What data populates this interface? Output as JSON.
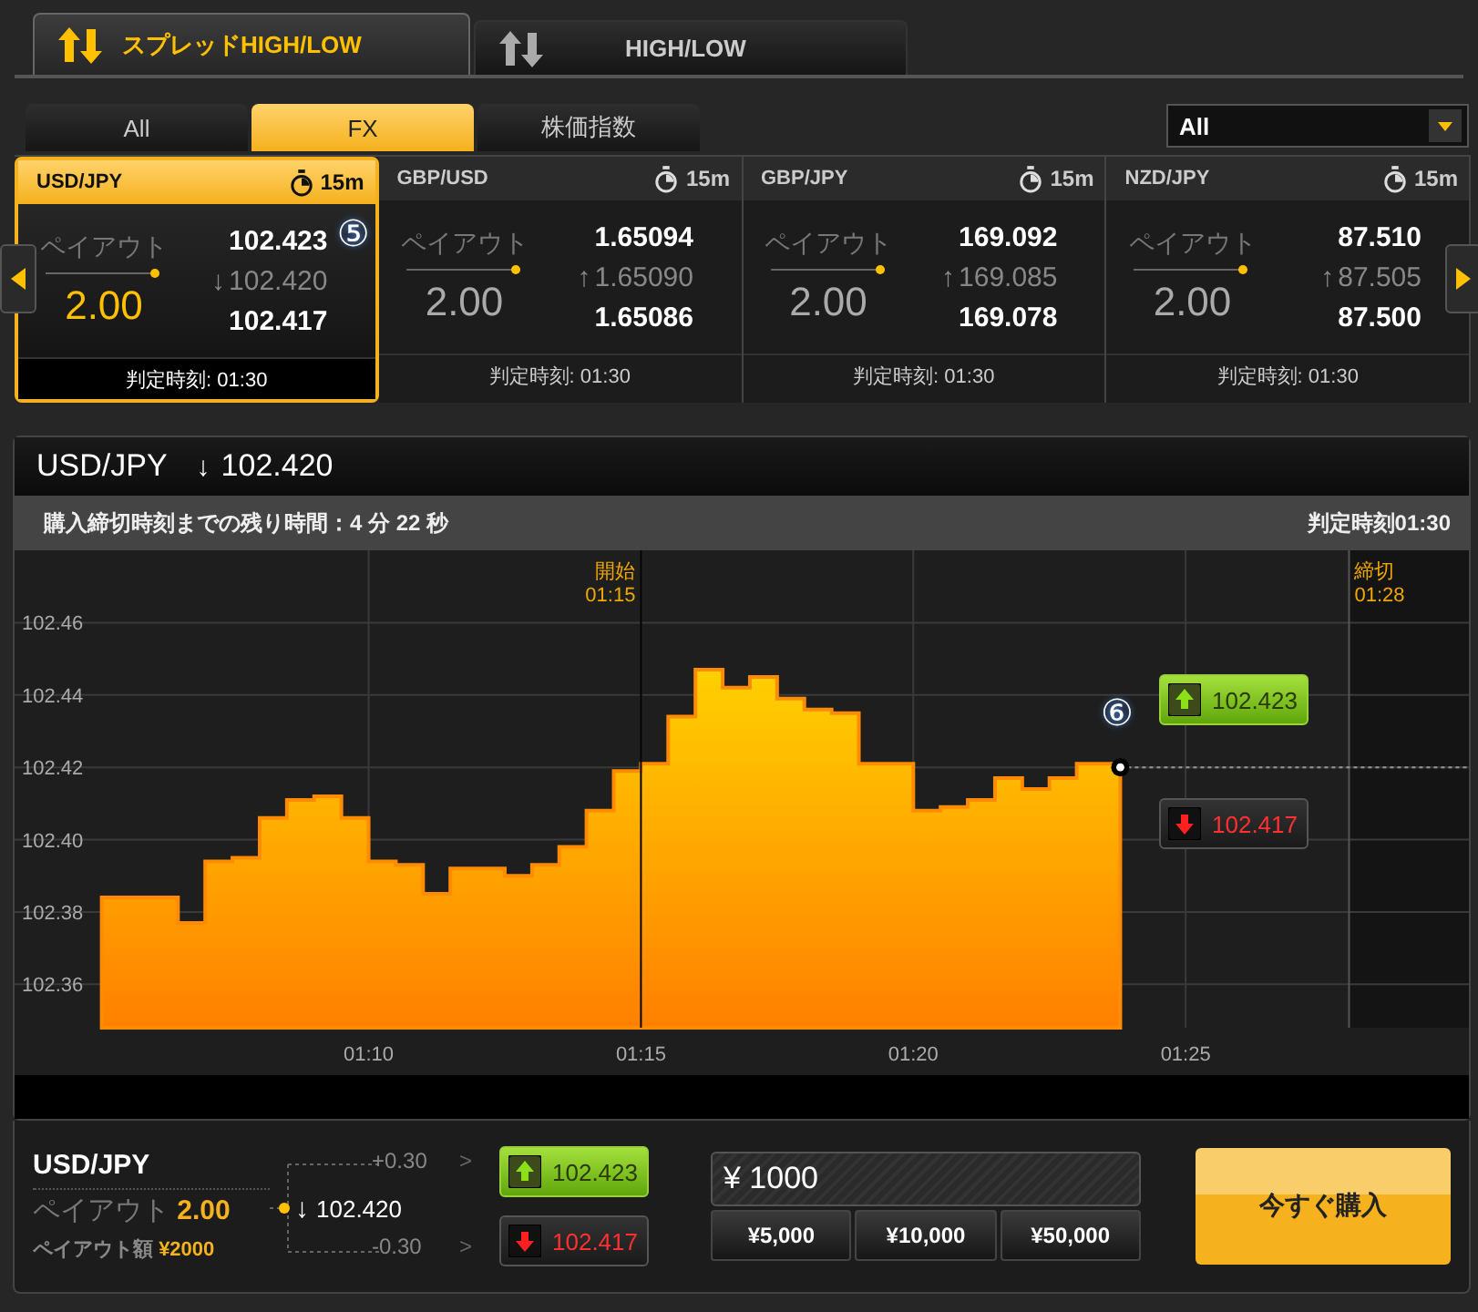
{
  "mode_tabs": [
    {
      "label": "スプレッドHIGH/LOW",
      "selected": true
    },
    {
      "label": "HIGH/LOW",
      "selected": false
    }
  ],
  "category_tabs": [
    {
      "label": "All",
      "selected": false
    },
    {
      "label": "FX",
      "selected": true
    },
    {
      "label": "株価指数",
      "selected": false
    }
  ],
  "filter_dropdown": {
    "value": "All"
  },
  "cards": [
    {
      "pair": "USD/JPY",
      "duration": "15m",
      "payout_label": "ペイアウト",
      "payout": "2.00",
      "high": "102.423",
      "mid": "102.420",
      "arrow": "↓",
      "low": "102.417",
      "judgement": "判定時刻: 01:30",
      "selected": true,
      "callout": "⑤"
    },
    {
      "pair": "GBP/USD",
      "duration": "15m",
      "payout_label": "ペイアウト",
      "payout": "2.00",
      "high": "1.65094",
      "mid": "1.65090",
      "arrow": "↑",
      "low": "1.65086",
      "judgement": "判定時刻: 01:30",
      "selected": false
    },
    {
      "pair": "GBP/JPY",
      "duration": "15m",
      "payout_label": "ペイアウト",
      "payout": "2.00",
      "high": "169.092",
      "mid": "169.085",
      "arrow": "↑",
      "low": "169.078",
      "judgement": "判定時刻: 01:30",
      "selected": false
    },
    {
      "pair": "NZD/JPY",
      "duration": "15m",
      "payout_label": "ペイアウト",
      "payout": "2.00",
      "high": "87.510",
      "mid": "87.505",
      "arrow": "↑",
      "low": "87.500",
      "judgement": "判定時刻: 01:30",
      "selected": false
    }
  ],
  "chart_panel": {
    "pair": "USD/JPY",
    "arrow": "↓",
    "price": "102.420",
    "remaining": "購入締切時刻までの残り時間：4 分 22 秒",
    "judgement": "判定時刻01:30",
    "high_button": "102.423",
    "low_button": "102.417",
    "callout": "⑥",
    "chart_data": {
      "type": "area",
      "x": [
        65.1,
        65.5,
        66,
        66.5,
        67,
        67.5,
        68,
        68.5,
        69,
        69.5,
        70,
        70.5,
        71,
        71.5,
        72,
        72.5,
        73,
        73.5,
        74,
        74.5,
        75,
        75.5,
        76,
        76.5,
        77,
        77.5,
        78,
        78.5,
        79,
        79.5,
        80,
        80.5,
        81,
        81.5,
        82,
        82.5,
        83,
        83.5,
        83.8
      ],
      "series": [
        {
          "color": "#ff8c00",
          "values": [
            102.384,
            102.384,
            102.384,
            102.377,
            102.394,
            102.395,
            102.406,
            102.411,
            102.412,
            102.406,
            102.394,
            102.393,
            102.385,
            102.392,
            102.392,
            102.39,
            102.393,
            102.398,
            102.408,
            102.419,
            102.421,
            102.434,
            102.447,
            102.442,
            102.445,
            102.439,
            102.436,
            102.435,
            102.421,
            102.421,
            102.408,
            102.409,
            102.411,
            102.417,
            102.414,
            102.417,
            102.421,
            102.421,
            102.42
          ]
        }
      ],
      "xlim": [
        63.5,
        90.2
      ],
      "ylim": [
        102.348,
        102.48
      ],
      "xticks": [
        {
          "value": 70,
          "label": "01:10"
        },
        {
          "value": 75,
          "label": "01:15"
        },
        {
          "value": 80,
          "label": "01:20"
        },
        {
          "value": 85,
          "label": "01:25"
        }
      ],
      "yticks": [
        {
          "value": 102.36,
          "label": "102.36"
        },
        {
          "value": 102.38,
          "label": "102.38"
        },
        {
          "value": 102.4,
          "label": "102.40"
        },
        {
          "value": 102.42,
          "label": "102.42"
        },
        {
          "value": 102.44,
          "label": "102.44"
        },
        {
          "value": 102.46,
          "label": "102.46"
        }
      ],
      "grid": true,
      "ref_lines": [
        {
          "axis": "x",
          "value": 75
        },
        {
          "axis": "x",
          "value": 88
        },
        {
          "axis": "y",
          "value": 102.42
        }
      ],
      "bands": [
        {
          "axis": "x",
          "from": 88,
          "to": 90.2
        }
      ]
    },
    "time_markers": [
      {
        "label": "開始",
        "time": "01:15"
      },
      {
        "label": "締切",
        "time": "01:28"
      }
    ]
  },
  "order_panel": {
    "pair": "USD/JPY",
    "payout_label": "ペイアウト",
    "payout": "2.00",
    "amount_label": "ペイアウト額",
    "amount": "¥2000",
    "upper": "+0.30",
    "lower": "-0.30",
    "chevron": ">",
    "arrow": "↓",
    "price": "102.420",
    "high_button": "102.423",
    "low_button": "102.417",
    "amount_field": "¥ 1000",
    "presets": [
      "¥5,000",
      "¥10,000",
      "¥50,000"
    ],
    "buy_button": "今すぐ購入"
  }
}
